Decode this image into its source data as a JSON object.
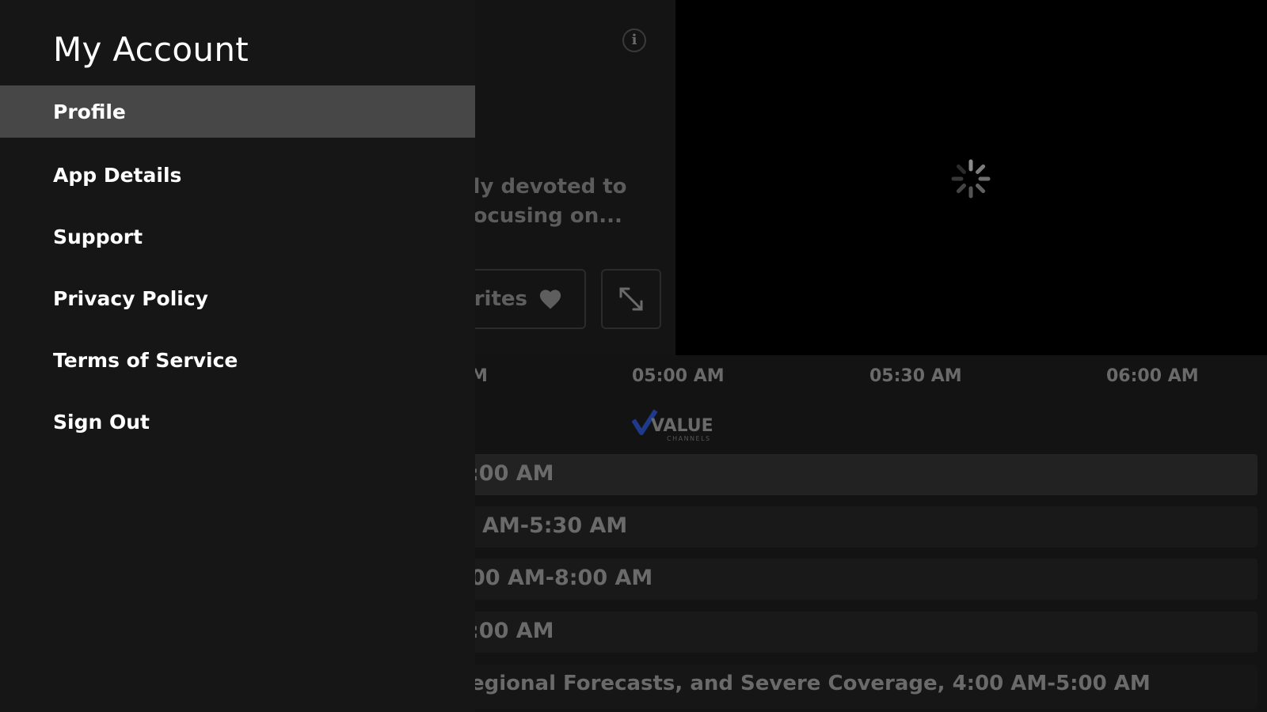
{
  "account_menu": {
    "title": "My Account",
    "items": [
      {
        "label": "Profile",
        "selected": true
      },
      {
        "label": "App Details",
        "selected": false
      },
      {
        "label": "Support",
        "selected": false
      },
      {
        "label": "Privacy Policy",
        "selected": false
      },
      {
        "label": "Terms of Service",
        "selected": false
      },
      {
        "label": "Sign Out",
        "selected": false
      }
    ]
  },
  "detail": {
    "description_line1": "merly devoted to",
    "description_line2": "ng focusing on...",
    "favorites_label": "orites",
    "info_icon": "info-icon",
    "favorites_icon": "heart-icon",
    "fullscreen_icon": "expand-icon"
  },
  "player": {
    "state": "loading",
    "spinner_icon": "loading-spinner-icon"
  },
  "guide": {
    "time_slots": [
      "M",
      "05:00 AM",
      "05:30 AM",
      "06:00 AM"
    ],
    "channel_logo_text": "VALUE",
    "channel_logo_subtext": "CHANNELS",
    "programs": [
      ":00 AM",
      "AM-5:30 AM",
      "00 AM-8:00 AM",
      ":00 AM",
      "egional Forecasts, and Severe Coverage, 4:00 AM-5:00 AM"
    ]
  },
  "colors": {
    "menu_background": "#161616",
    "menu_selected": "#474747",
    "menu_text": "#ffffff",
    "dimmed_text": "#6a6a6a",
    "player_background": "#000000",
    "logo_blue": "#1f3a8a"
  }
}
